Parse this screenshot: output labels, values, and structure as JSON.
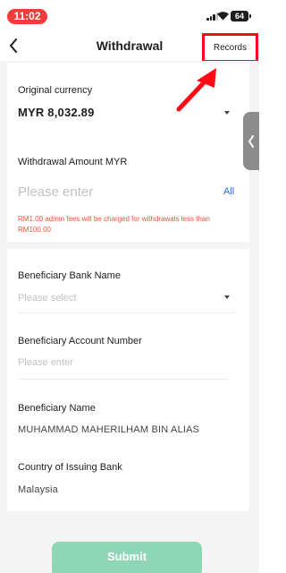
{
  "status_bar": {
    "time": "11:02",
    "battery": "64"
  },
  "header": {
    "title": "Withdrawal",
    "records_label": "Records"
  },
  "form": {
    "original_currency": {
      "label": "Original currency",
      "value": "MYR 8,032.89"
    },
    "withdrawal_amount": {
      "label": "Withdrawal Amount MYR",
      "placeholder": "Please enter",
      "all_label": "All",
      "fee_note": "RM1.00 admin fees will be charged for withdrawals less than RM100.00"
    },
    "beneficiary_bank_name": {
      "label": "Beneficiary Bank Name",
      "placeholder": "Please select"
    },
    "beneficiary_account_number": {
      "label": "Beneficiary Account Number",
      "placeholder": "Please enter"
    },
    "beneficiary_name": {
      "label": "Beneficiary Name",
      "value": "MUHAMMAD MAHERILHAM BIN ALIAS"
    },
    "country_of_issuing_bank": {
      "label": "Country of Issuing Bank",
      "value": "Malaysia"
    }
  },
  "submit_label": "Submit",
  "colors": {
    "accent": "#8fd6b6",
    "link": "#2a6fd6",
    "warning": "#e8553a",
    "highlight": "#ff0a14",
    "time_pill": "#f03c3c"
  },
  "icons": [
    "back-chevron-icon",
    "cellular-signal-icon",
    "wifi-icon",
    "battery-icon",
    "dropdown-caret-icon",
    "collapse-chevron-icon",
    "annotation-arrow"
  ]
}
